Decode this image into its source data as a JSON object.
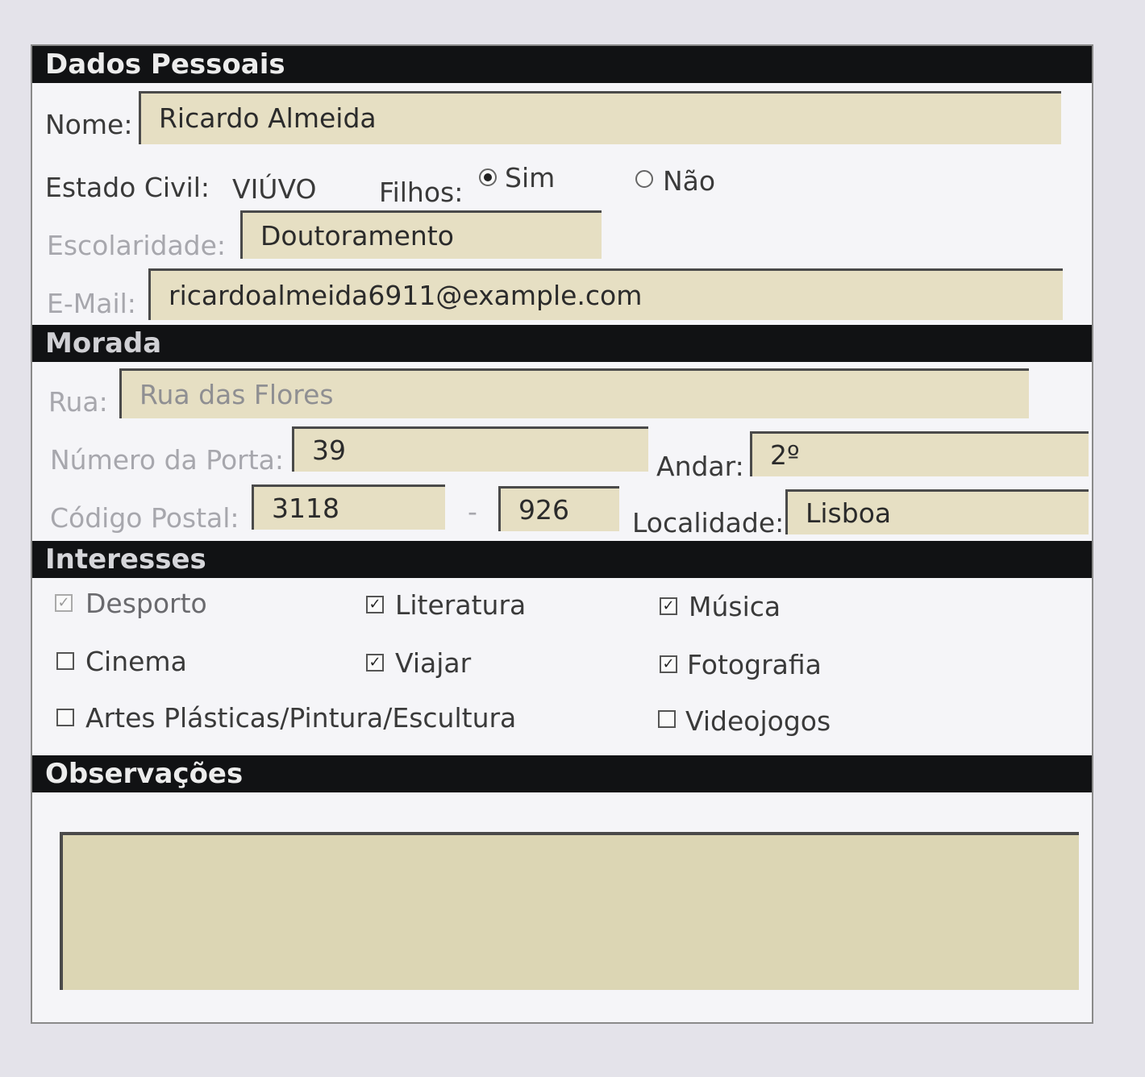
{
  "sections": {
    "dados_pessoais": "Dados Pessoais",
    "morada": "Morada",
    "interesses": "Interesses",
    "observacoes": "Observações"
  },
  "dados": {
    "nome_label": "Nome:",
    "nome_value": "Ricardo Almeida",
    "estado_civil_label": "Estado Civil:",
    "estado_civil_value": "VIÚVO",
    "filhos_label": "Filhos:",
    "filhos_options": [
      {
        "label": "Sim",
        "selected": true
      },
      {
        "label": "Não",
        "selected": false
      }
    ],
    "escolaridade_label": "Escolaridade:",
    "escolaridade_value": "Doutoramento",
    "email_label": "E-Mail:",
    "email_value": "ricardoalmeida6911@example.com"
  },
  "morada": {
    "rua_label": "Rua:",
    "rua_value": "Rua das Flores",
    "porta_label": "Número da Porta:",
    "porta_value": "39",
    "andar_label": "Andar:",
    "andar_value": "2º",
    "cp_label": "Código Postal:",
    "cp1_value": "3118",
    "cp_sep": "-",
    "cp2_value": "926",
    "localidade_label": "Localidade:",
    "localidade_value": "Lisboa"
  },
  "interesses": [
    {
      "label": "Desporto",
      "checked": true
    },
    {
      "label": "Literatura",
      "checked": true
    },
    {
      "label": "Música",
      "checked": true
    },
    {
      "label": "Cinema",
      "checked": false
    },
    {
      "label": "Viajar",
      "checked": true
    },
    {
      "label": "Fotografia",
      "checked": true
    },
    {
      "label": "Artes Plásticas/Pintura/Escultura",
      "checked": false
    },
    {
      "label": "Videojogos",
      "checked": false
    }
  ],
  "observacoes_value": "",
  "colors": {
    "field_bg": "#e6dfc3",
    "section_bar": "#111214",
    "page_bg": "#e4e3ea"
  }
}
